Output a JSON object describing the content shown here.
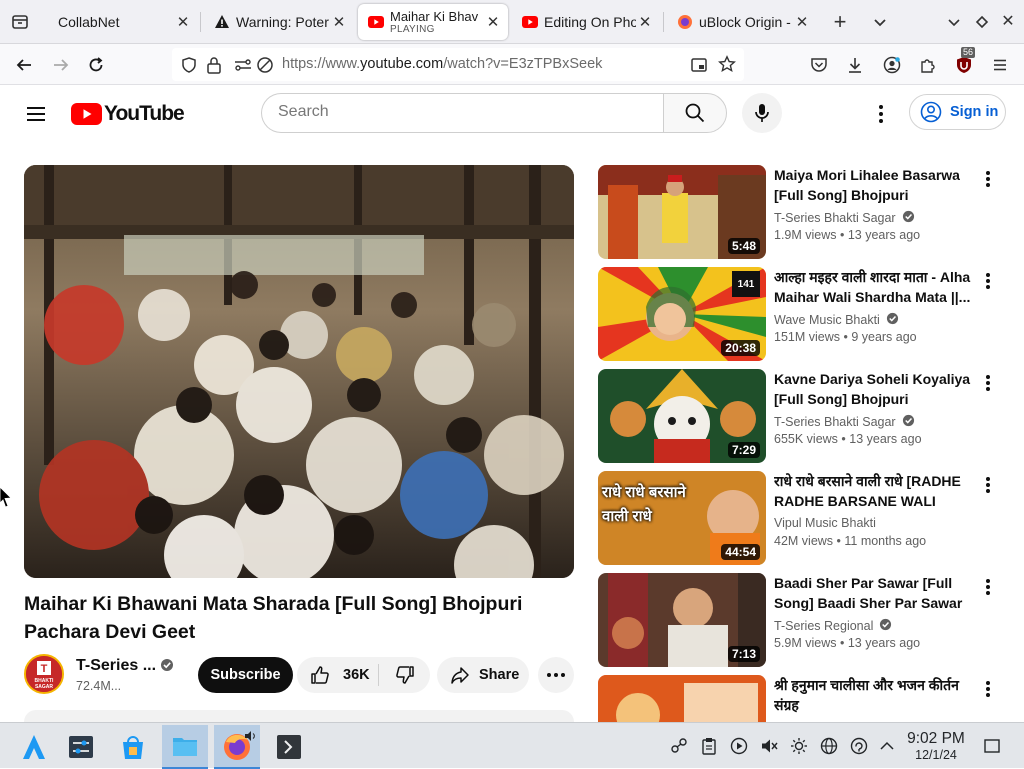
{
  "browser": {
    "tabs": [
      {
        "title": "CollabNet",
        "icon": "collabnet"
      },
      {
        "title": "Warning: Poter",
        "icon": "warning"
      },
      {
        "title": "Maihar Ki Bhav",
        "subtitle": "PLAYING",
        "icon": "youtube",
        "active": true
      },
      {
        "title": "Editing On Pho",
        "icon": "youtube"
      },
      {
        "title": "uBlock Origin -",
        "icon": "firefox"
      }
    ],
    "url_prefix": "https://www.",
    "url_domain": "youtube.com",
    "url_rest": "/watch?v=E3zTPBxSeek",
    "ublock_count": "56"
  },
  "youtube": {
    "logo_text": "YouTube",
    "search_placeholder": "Search",
    "signin_label": "Sign in"
  },
  "video": {
    "title": "Maihar Ki Bhawani Mata Sharada [Full Song] Bhojpuri Pachara Devi Geet",
    "channel_name": "T-Series ...",
    "subscribers": "72.4M...",
    "subscribe_label": "Subscribe",
    "likes": "36K",
    "share_label": "Share",
    "avatar_text": "BHAKTI SAGAR"
  },
  "recommendations": [
    {
      "title": "Maiya Mori Lihalee Basarwa [Full Song] Bhojpuri Pachara...",
      "channel": "T-Series Bhakti Sagar",
      "verified": true,
      "meta": "1.9M views • 13 years ago",
      "duration": "5:48"
    },
    {
      "title": "आल्हा मइहर वाली शारदा माता - Alha Maihar Wali Shardha Mata ||...",
      "channel": "Wave Music Bhakti",
      "verified": true,
      "meta": "151M views • 9 years ago",
      "duration": "20:38"
    },
    {
      "title": "Kavne Dariya Soheli Koyaliya [Full Song] Bhojpuri Pachara...",
      "channel": "T-Series Bhakti Sagar",
      "verified": true,
      "meta": "655K views • 13 years ago",
      "duration": "7:29"
    },
    {
      "title": "राधे राधे बरसाने वाली राधे [RADHE RADHE BARSANE WALI RADH...",
      "channel": "Vipul Music Bhakti",
      "verified": false,
      "meta": "42M views • 11 months ago",
      "duration": "44:54",
      "thumb_text": "राधे राधे बरसाने वाली राधे"
    },
    {
      "title": "Baadi Sher Par Sawar [Full Song] Baadi Sher Par Sawar",
      "channel": "T-Series Regional",
      "verified": true,
      "meta": "5.9M views • 13 years ago",
      "duration": "7:13"
    },
    {
      "title": "श्री हनुमान चालीसा और भजन कीर्तन संग्रह",
      "channel": "",
      "verified": false,
      "meta": "",
      "duration": ""
    }
  ],
  "taskbar": {
    "time": "9:02 PM",
    "date": "12/1/24"
  },
  "colors": {
    "youtube_red": "#ff0000",
    "signin_blue": "#065fd4",
    "taskbar_bg": "#e3e6ea",
    "taskbar_active": "#b7cde4"
  }
}
